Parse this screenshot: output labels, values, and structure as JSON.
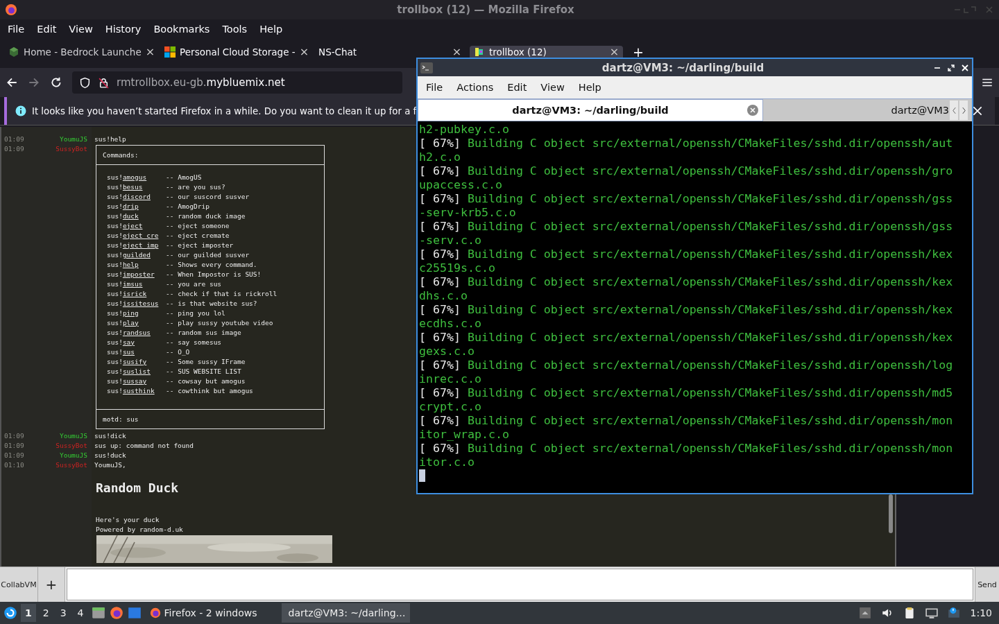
{
  "firefox": {
    "title": "trollbox (12) — Mozilla Firefox",
    "menu": [
      "File",
      "Edit",
      "View",
      "History",
      "Bookmarks",
      "Tools",
      "Help"
    ],
    "tabs": [
      {
        "label": "Home - Bedrock Launche",
        "selected": false,
        "kind": "cube",
        "close": "×"
      },
      {
        "label": "Personal Cloud Storage -",
        "selected": false,
        "kind": "squares",
        "close": "×"
      },
      {
        "label": "NS-Chat",
        "selected": false,
        "kind": "none",
        "close": "×"
      },
      {
        "label": "trollbox (12)",
        "selected": true,
        "kind": "pixel",
        "close": "×"
      }
    ],
    "new_tab": "+",
    "url": {
      "prefix": "rmtrollbox.eu-gb.",
      "domain": "mybluemix.net"
    },
    "notice": "It looks like you haven’t started Firefox in a while. Do you want to clean it up for a f"
  },
  "chat": {
    "before": [
      {
        "time": "01:09",
        "nick": "YoumuJS",
        "color": "#33cc33",
        "text": "sus!help"
      },
      {
        "time": "01:09",
        "nick": "SussyBot",
        "color": "#cc2222"
      }
    ],
    "help": {
      "heading": "Commands:",
      "commands": [
        {
          "prefix": "sus!",
          "name": "amogus",
          "desc": "-- AmogUS"
        },
        {
          "prefix": "sus!",
          "name": "besus",
          "desc": "-- are you sus?"
        },
        {
          "prefix": "sus!",
          "name": "discord",
          "desc": "-- our suscord susver"
        },
        {
          "prefix": "sus!",
          "name": "drip",
          "desc": "-- AmogDrip"
        },
        {
          "prefix": "sus!",
          "name": "duck",
          "desc": "-- random duck image"
        },
        {
          "prefix": "sus!",
          "name": "eject",
          "desc": "-- eject someone"
        },
        {
          "prefix": "sus!",
          "name": "eject_cre",
          "desc": "-- eject cremate"
        },
        {
          "prefix": "sus!",
          "name": "eject_imp",
          "desc": "-- eject imposter"
        },
        {
          "prefix": "sus!",
          "name": "guilded",
          "desc": "-- our guilded susver"
        },
        {
          "prefix": "sus!",
          "name": "help",
          "desc": "-- Shows every command."
        },
        {
          "prefix": "sus!",
          "name": "imposter",
          "desc": "-- When Impostor is SUS!"
        },
        {
          "prefix": "sus!",
          "name": "imsus",
          "desc": "-- you are sus"
        },
        {
          "prefix": "sus!",
          "name": "isrick",
          "desc": "-- check if that is rickroll"
        },
        {
          "prefix": "sus!",
          "name": "issitesus",
          "desc": "-- is that website sus?"
        },
        {
          "prefix": "sus!",
          "name": "ping",
          "desc": "-- ping you lol"
        },
        {
          "prefix": "sus!",
          "name": "play",
          "desc": "-- play sussy youtube video"
        },
        {
          "prefix": "sus!",
          "name": "randsus",
          "desc": "-- random sus image"
        },
        {
          "prefix": "sus!",
          "name": "say",
          "desc": "-- say somesus"
        },
        {
          "prefix": "sus!",
          "name": "sus",
          "desc": "-- O_O"
        },
        {
          "prefix": "sus!",
          "name": "susify",
          "desc": "-- Some sussy IFrame"
        },
        {
          "prefix": "sus!",
          "name": "suslist",
          "desc": "-- SUS WEBSITE LIST"
        },
        {
          "prefix": "sus!",
          "name": "sussay",
          "desc": "-- cowsay but amogus"
        },
        {
          "prefix": "sus!",
          "name": "susthink",
          "desc": "-- cowthink but amogus"
        }
      ],
      "motd": "motd: sus"
    },
    "after": [
      {
        "time": "01:09",
        "nick": "YoumuJS",
        "color": "#33cc33",
        "text": "sus!dick"
      },
      {
        "time": "01:09",
        "nick": "SussyBot",
        "color": "#cc2222",
        "text": "sus up: command not found"
      },
      {
        "time": "01:09",
        "nick": "YoumuJS",
        "color": "#33cc33",
        "text": "sus!duck"
      },
      {
        "time": "01:10",
        "nick": "SussyBot",
        "color": "#cc2222",
        "text": "YoumuJS,"
      }
    ],
    "duck": {
      "title": "Random Duck",
      "lines": [
        "Here's your duck",
        "Powered by random-d.uk"
      ]
    }
  },
  "terminal": {
    "title": "dartz@VM3: ~/darling/build",
    "menu": [
      "File",
      "Actions",
      "Edit",
      "View",
      "Help"
    ],
    "tabs": [
      {
        "label": "dartz@VM3: ~/darling/build",
        "selected": true
      },
      {
        "label": "dartz@VM3",
        "selected": false
      }
    ],
    "lines": [
      {
        "text": "h2-pubkey.c.o"
      },
      {
        "percent": "[ 67%]",
        "text": " Building C object src/external/openssh/CMakeFiles/sshd.dir/openssh/auth2.c.o"
      },
      {
        "percent": "[ 67%]",
        "text": " Building C object src/external/openssh/CMakeFiles/sshd.dir/openssh/groupaccess.c.o"
      },
      {
        "percent": "[ 67%]",
        "text": " Building C object src/external/openssh/CMakeFiles/sshd.dir/openssh/gss-serv-krb5.c.o"
      },
      {
        "percent": "[ 67%]",
        "text": " Building C object src/external/openssh/CMakeFiles/sshd.dir/openssh/gss-serv.c.o"
      },
      {
        "percent": "[ 67%]",
        "text": " Building C object src/external/openssh/CMakeFiles/sshd.dir/openssh/kexc25519s.c.o"
      },
      {
        "percent": "[ 67%]",
        "text": " Building C object src/external/openssh/CMakeFiles/sshd.dir/openssh/kexdhs.c.o"
      },
      {
        "percent": "[ 67%]",
        "text": " Building C object src/external/openssh/CMakeFiles/sshd.dir/openssh/kexecdhs.c.o"
      },
      {
        "percent": "[ 67%]",
        "text": " Building C object src/external/openssh/CMakeFiles/sshd.dir/openssh/kexgexs.c.o"
      },
      {
        "percent": "[ 67%]",
        "text": " Building C object src/external/openssh/CMakeFiles/sshd.dir/openssh/loginrec.c.o"
      },
      {
        "percent": "[ 67%]",
        "text": " Building C object src/external/openssh/CMakeFiles/sshd.dir/openssh/md5crypt.c.o"
      },
      {
        "percent": "[ 67%]",
        "text": " Building C object src/external/openssh/CMakeFiles/sshd.dir/openssh/monitor_wrap.c.o"
      },
      {
        "percent": "[ 67%]",
        "text": " Building C object src/external/openssh/CMakeFiles/sshd.dir/openssh/monitor.c.o"
      }
    ]
  },
  "collabvm": {
    "brand": "CollabVM",
    "add": "+",
    "send": "Send"
  },
  "taskbar": {
    "workspaces": [
      {
        "label": "1",
        "selected": true
      },
      {
        "label": "2",
        "selected": false
      },
      {
        "label": "3",
        "selected": false
      },
      {
        "label": "4",
        "selected": false
      }
    ],
    "tasks": [
      {
        "label": "Firefox - 2 windows",
        "selected": false,
        "kind": "firefox"
      },
      {
        "label": "dartz@VM3: ~/darling…",
        "selected": true,
        "kind": "terminal"
      }
    ],
    "clock": "1:10"
  }
}
